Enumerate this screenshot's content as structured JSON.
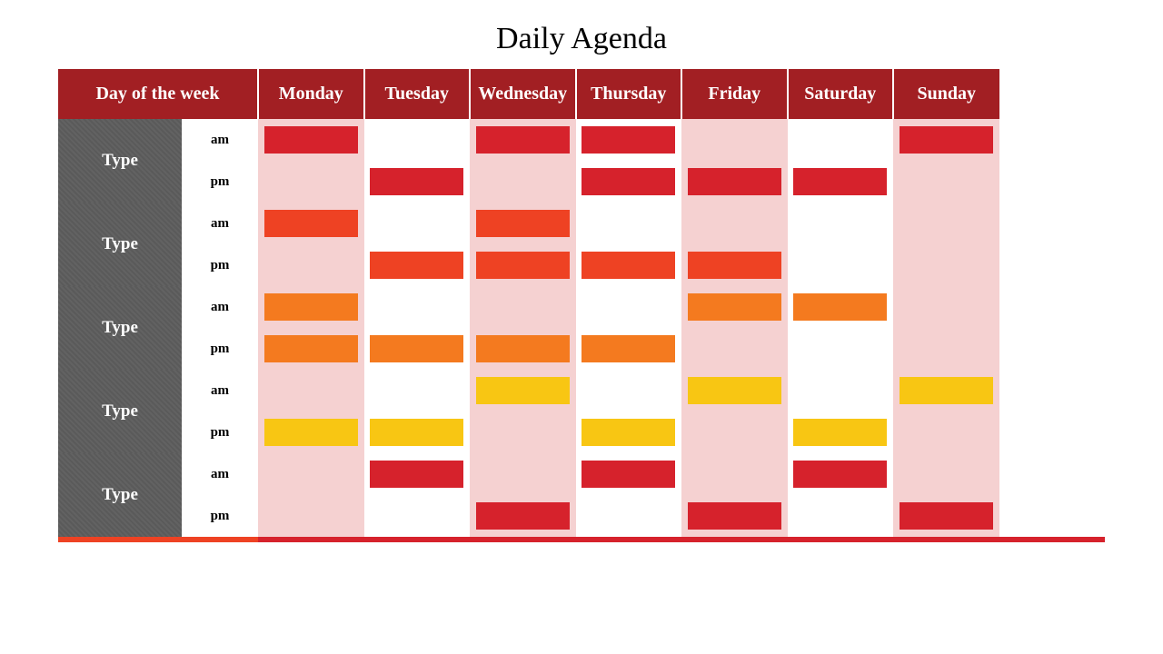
{
  "title": "Daily Agenda",
  "header": {
    "day_of_week": "Day of the week",
    "days": [
      "Monday",
      "Tuesday",
      "Wednesday",
      "Thursday",
      "Friday",
      "Saturday",
      "Sunday"
    ]
  },
  "ampm": {
    "am": "am",
    "pm": "pm"
  },
  "type_label": "Type",
  "colors": {
    "red": "#d6222c",
    "darkorange": "#ee4223",
    "orange": "#f47a1f",
    "yellow": "#f8c613"
  },
  "shaded_days": [
    0,
    2,
    4,
    6
  ],
  "rows": [
    {
      "label": "Type",
      "am": [
        "red",
        null,
        "red",
        "red",
        null,
        null,
        "red"
      ],
      "pm": [
        null,
        "red",
        null,
        "red",
        "red",
        "red",
        null
      ]
    },
    {
      "label": "Type",
      "am": [
        "darkorange",
        null,
        "darkorange",
        null,
        null,
        null,
        null
      ],
      "pm": [
        null,
        "darkorange",
        "darkorange",
        "darkorange",
        "darkorange",
        null,
        null
      ]
    },
    {
      "label": "Type",
      "am": [
        "orange",
        null,
        null,
        null,
        "orange",
        "orange",
        null
      ],
      "pm": [
        "orange",
        "orange",
        "orange",
        "orange",
        null,
        null,
        null
      ]
    },
    {
      "label": "Type",
      "am": [
        null,
        null,
        "yellow",
        null,
        "yellow",
        null,
        "yellow"
      ],
      "pm": [
        "yellow",
        "yellow",
        null,
        "yellow",
        null,
        "yellow",
        null
      ]
    },
    {
      "label": "Type",
      "am": [
        null,
        "red",
        null,
        "red",
        null,
        "red",
        null
      ],
      "pm": [
        null,
        null,
        "red",
        null,
        "red",
        null,
        "red"
      ]
    }
  ],
  "footer_colors": [
    "#ee4223",
    "#d6222c",
    "#d6222c",
    "#d6222c",
    "#d6222c",
    "#d6222c",
    "#d6222c",
    "#d6222c",
    "#d6222c"
  ]
}
